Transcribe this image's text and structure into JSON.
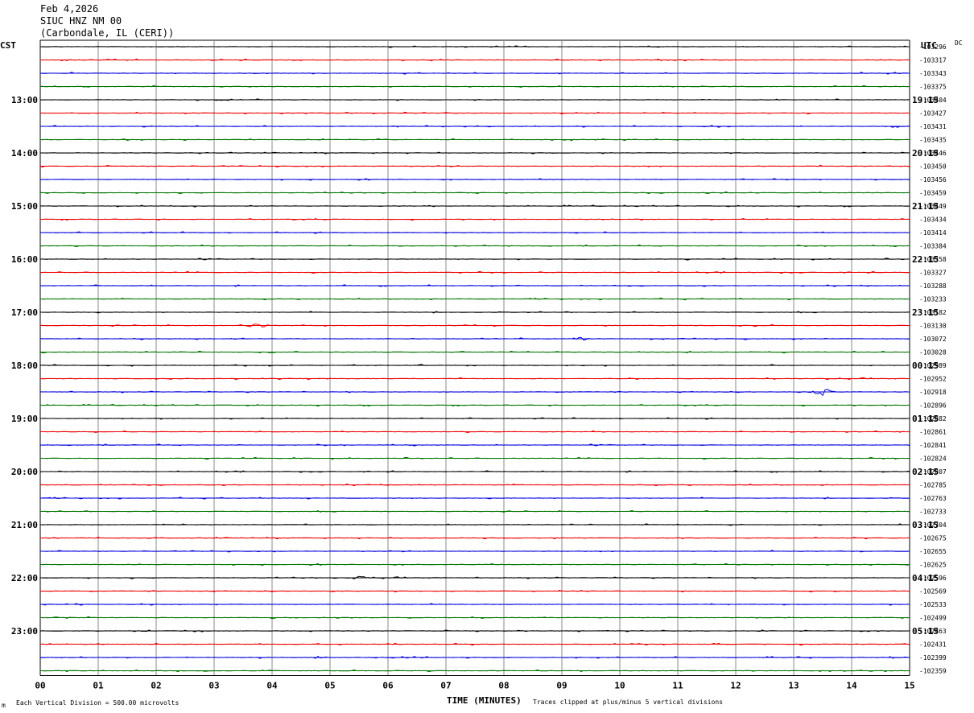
{
  "header": {
    "date": "Feb 4,2026",
    "station": "SIUC HNZ NM 00",
    "location": "(Carbondale, IL (CERI))"
  },
  "left_axis_title": "CST",
  "right_axis_title": "UTC",
  "dc_header": "DC",
  "footer": {
    "scale_note": "Each Vertical Division =   500.00 microvolts",
    "clip_note": "Traces clipped at plus/minus 5 vertical divisions",
    "mark": "m"
  },
  "colors": {
    "trace_cycle": [
      "#000000",
      "#ee0000",
      "#0000dd",
      "#007700"
    ],
    "grid": "#000000"
  },
  "chart_data": {
    "type": "line",
    "title": "SIUC HNZ NM 00",
    "xlabel": "TIME (MINUTES)",
    "x_ticks": [
      "00",
      "01",
      "02",
      "03",
      "04",
      "05",
      "06",
      "07",
      "08",
      "09",
      "10",
      "11",
      "12",
      "13",
      "14",
      "15"
    ],
    "xlim": [
      0,
      15
    ],
    "cst_hour_labels": [
      "13:00",
      "14:00",
      "15:00",
      "16:00",
      "17:00",
      "18:00",
      "19:00",
      "20:00",
      "21:00",
      "22:00",
      "23:00"
    ],
    "utc_hour_labels": [
      "19:15",
      "20:15",
      "21:15",
      "22:15",
      "23:15",
      "00:15",
      "01:15",
      "02:15",
      "03:15",
      "04:15",
      "05:15"
    ],
    "dc_offsets": [
      "-103296",
      "-103317",
      "-103343",
      "-103375",
      "-103404",
      "-103427",
      "-103431",
      "-103435",
      "-103446",
      "-103450",
      "-103456",
      "-103459",
      "-103449",
      "-103434",
      "-103414",
      "-103384",
      "-103358",
      "-103327",
      "-103288",
      "-103233",
      "-103182",
      "-103130",
      "-103072",
      "-103028",
      "-102989",
      "-102952",
      "-102918",
      "-102896",
      "-102882",
      "-102861",
      "-102841",
      "-102824",
      "-102807",
      "-102785",
      "-102763",
      "-102733",
      "-102704",
      "-102675",
      "-102655",
      "-102625",
      "-102596",
      "-102569",
      "-102533",
      "-102499",
      "-102463",
      "-102431",
      "-102399",
      "-102359"
    ],
    "notable_events": [
      {
        "line": 21,
        "minute": 3.75,
        "amp": 0.4
      },
      {
        "line": 22,
        "minute": 9.3,
        "amp": 0.3
      },
      {
        "line": 26,
        "minute": 13.5,
        "amp": 0.6
      },
      {
        "line": 40,
        "minute": 5.5,
        "amp": 0.3
      },
      {
        "line": 46,
        "minute": 4.8,
        "amp": 0.2
      }
    ]
  }
}
